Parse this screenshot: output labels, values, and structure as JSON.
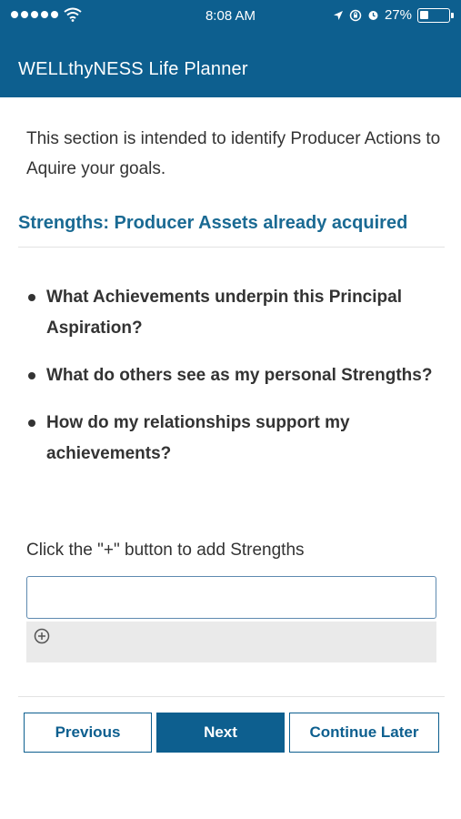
{
  "status_bar": {
    "time": "8:08 AM",
    "battery": "27%",
    "icons": [
      "signal-dots-icon",
      "wifi-icon",
      "location-arrow-icon",
      "screen-lock-icon",
      "alarm-icon",
      "battery-icon"
    ]
  },
  "header": {
    "title": "WELLthyNESS Life Planner"
  },
  "intro": {
    "text": "This section is intended to identify Producer Actions to Aquire your goals."
  },
  "section": {
    "heading": "Strengths: Producer Assets already acquired",
    "questions": [
      "What Achievements underpin this Principal Aspiration?",
      "What do others see as my personal Strengths?",
      "How do my relationships support my achievements?"
    ]
  },
  "strengths": {
    "hint": "Click the \"+\" button to add Strengths",
    "input_value": "",
    "add_icon": "plus-circle-icon"
  },
  "footer": {
    "previous_label": "Previous",
    "next_label": "Next",
    "continue_label": "Continue Later"
  },
  "colors": {
    "brand": "#0d5f8f",
    "heading": "#1a6a93",
    "add_bar": "#eaeaea"
  }
}
